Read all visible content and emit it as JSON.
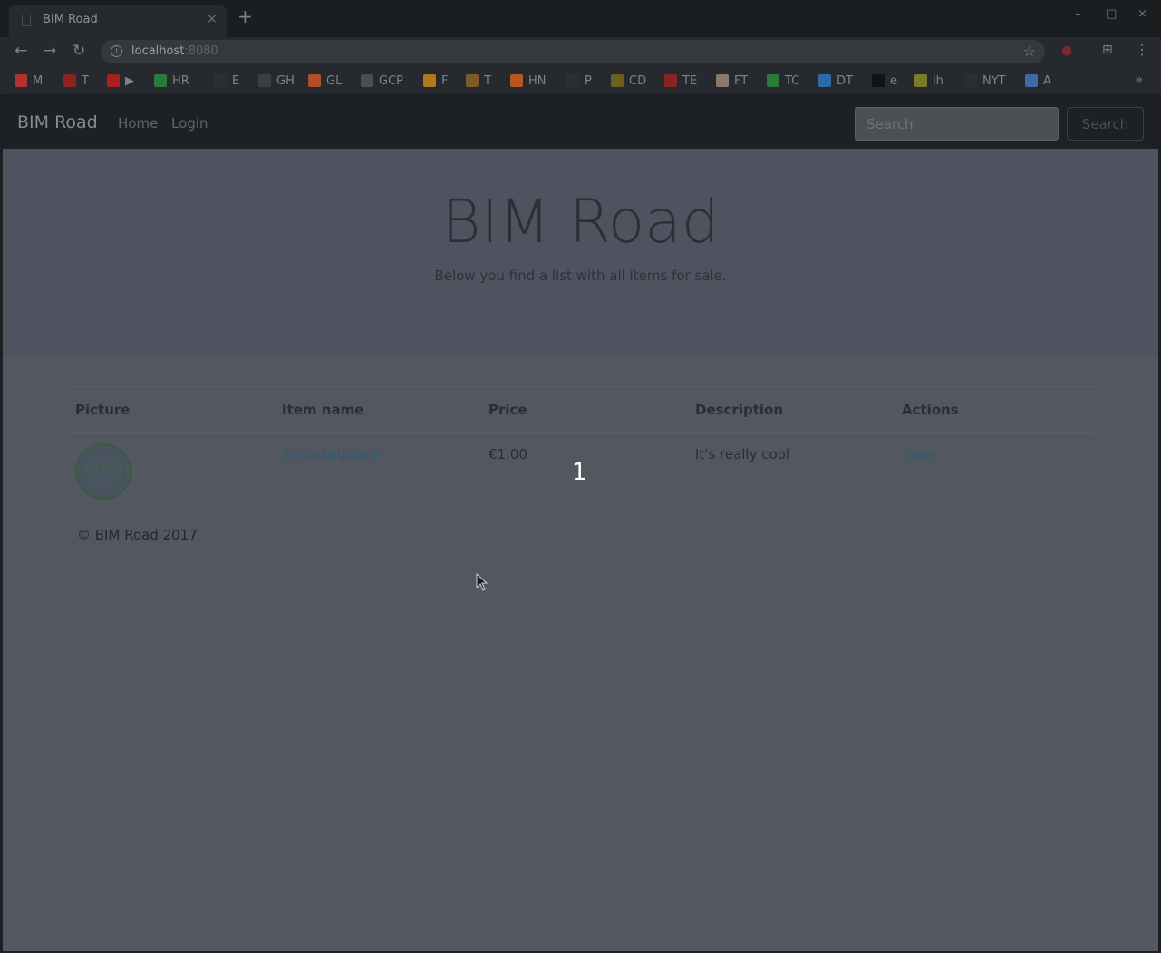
{
  "browser": {
    "tab_title": "BIM Road",
    "tab_close": "×",
    "new_tab": "+",
    "window_controls": [
      "–",
      "□",
      "×"
    ],
    "url_host": "localhost",
    "url_port": ":8080",
    "bookmarks": [
      {
        "label": "M",
        "color": "#b3312f"
      },
      {
        "label": "T",
        "color": "#8c2323"
      },
      {
        "label": "▶",
        "color": "#a82020"
      },
      {
        "label": "HR",
        "color": "#2b7a3a"
      },
      {
        "label": "E",
        "color": "#2b2f33"
      },
      {
        "label": "GH",
        "color": "#3a3e42"
      },
      {
        "label": "GL",
        "color": "#b24d2b"
      },
      {
        "label": "GCP",
        "color": "#4a4f54"
      },
      {
        "label": "F",
        "color": "#b07a1c"
      },
      {
        "label": "T",
        "color": "#7b5a2b"
      },
      {
        "label": "HN",
        "color": "#b8561f"
      },
      {
        "label": "P",
        "color": "#2b2f33"
      },
      {
        "label": "CD",
        "color": "#6c6020"
      },
      {
        "label": "TE",
        "color": "#8c2323"
      },
      {
        "label": "FT",
        "color": "#8a7a6a"
      },
      {
        "label": "TC",
        "color": "#2a7a3a"
      },
      {
        "label": "DT",
        "color": "#2f6aa6"
      },
      {
        "label": "e",
        "color": "#111315"
      },
      {
        "label": "lh",
        "color": "#7a7a2a"
      },
      {
        "label": "NYT",
        "color": "#2b2f33"
      },
      {
        "label": "A",
        "color": "#3f6aa6"
      }
    ],
    "bookmarks_more": "»"
  },
  "navbar": {
    "brand": "BIM Road",
    "links": [
      "Home",
      "Login"
    ],
    "search_placeholder": "Search",
    "search_button": "Search"
  },
  "jumbotron": {
    "title": "BIM Road",
    "lead": "Below you find a list with all items for sale."
  },
  "table": {
    "headers": [
      "Picture",
      "Item name",
      "Price",
      "Description",
      "Actions"
    ],
    "rows": [
      {
        "item_name": "A Marketplace",
        "price": "€1.00",
        "description": "It's really cool",
        "action": "View",
        "picture_text": "BIM ROAD"
      }
    ]
  },
  "footer": "© BIM Road 2017",
  "overlay_number": "1",
  "colors": {
    "accent_link": "#2f5a75",
    "page_bg": "#525760",
    "navbar_bg": "#1d2125"
  }
}
